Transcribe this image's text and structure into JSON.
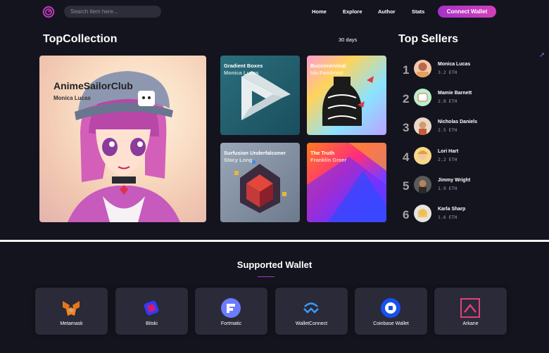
{
  "header": {
    "search_placeholder": "Search item here...",
    "nav": [
      "Home",
      "Explore",
      "Author",
      "Stats"
    ],
    "connect_label": "Connect Wallet"
  },
  "collection": {
    "title": "TopCollection",
    "period": "30 days",
    "featured": {
      "title": "AnimeSailorClub",
      "author": "Monica Lucas"
    },
    "items": [
      {
        "title": "Gradient Boxes",
        "author": "Monica Lucas"
      },
      {
        "title": "Buccecervical",
        "author": "Ida Fambrest"
      },
      {
        "title": "Surfusion Underfalconer",
        "author": "Stacy Long"
      },
      {
        "title": "The Truth",
        "author": "Franklin Greer"
      }
    ]
  },
  "sellers": {
    "title": "Top Sellers",
    "items": [
      {
        "rank": "1",
        "name": "Monica Lucas",
        "eth": "3.2 ETH"
      },
      {
        "rank": "2",
        "name": "Mamie Barnett",
        "eth": "2.8 ETH"
      },
      {
        "rank": "3",
        "name": "Nicholas Daniels",
        "eth": "2.5 ETH"
      },
      {
        "rank": "4",
        "name": "Lori Hart",
        "eth": "2.2 ETH"
      },
      {
        "rank": "5",
        "name": "Jimmy Wright",
        "eth": "1.9 ETH"
      },
      {
        "rank": "6",
        "name": "Karla Sharp",
        "eth": "1.6 ETH"
      }
    ]
  },
  "wallets": {
    "title": "Supported Wallet",
    "items": [
      "Metamask",
      "Bitski",
      "Fortmatic",
      "WalletConnect",
      "Coinbase Wallet",
      "Arkane"
    ]
  },
  "colors": {
    "accent": "#c03ac0",
    "background": "#14141f",
    "card": "#2a2a38"
  }
}
